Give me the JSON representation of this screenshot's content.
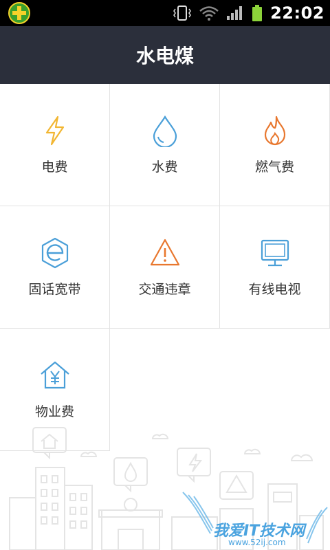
{
  "status_bar": {
    "time": "22:02",
    "icons": [
      "app-plus-icon",
      "vibrate-icon",
      "wifi-icon",
      "signal-icon",
      "battery-icon"
    ]
  },
  "header": {
    "title": "水电煤"
  },
  "services": [
    {
      "label": "电费",
      "icon": "lightning-icon",
      "color": "#f2b632"
    },
    {
      "label": "水费",
      "icon": "water-drop-icon",
      "color": "#4a9fd8"
    },
    {
      "label": "燃气费",
      "icon": "flame-icon",
      "color": "#e8772e"
    },
    {
      "label": "固话宽带",
      "icon": "broadband-globe-icon",
      "color": "#4a9fd8"
    },
    {
      "label": "交通违章",
      "icon": "warning-triangle-icon",
      "color": "#e8772e"
    },
    {
      "label": "有线电视",
      "icon": "tv-icon",
      "color": "#4a9fd8"
    },
    {
      "label": "物业费",
      "icon": "property-house-icon",
      "color": "#4a9fd8"
    }
  ],
  "watermark": {
    "text": "我爱IT技术网",
    "sub": "www.52ij.com"
  }
}
